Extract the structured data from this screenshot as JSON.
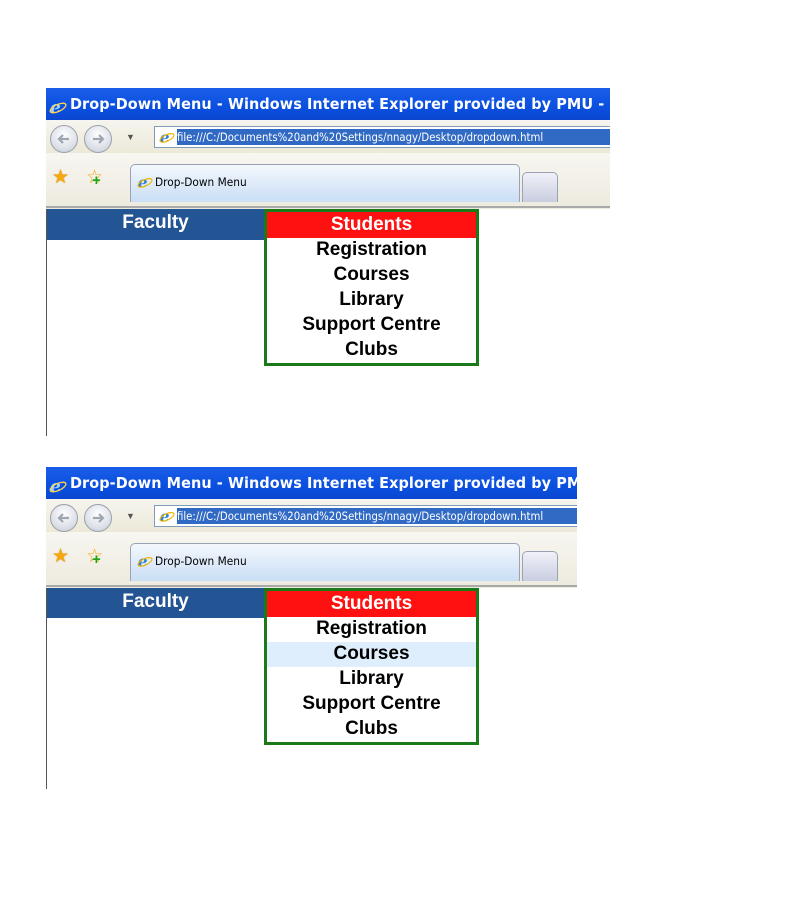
{
  "screenshots": [
    {
      "window_title": "Drop-Down Menu - Windows Internet Explorer provided by PMU - I",
      "address_url": "file:///C:/Documents%20and%20Settings/nnagy/Desktop/dropdown.html",
      "tab_label": "Drop-Down Menu",
      "nav": {
        "faculty": "Faculty",
        "students": "Students"
      },
      "menu_items": [
        "Registration",
        "Courses",
        "Library",
        "Support Centre",
        "Clubs"
      ],
      "hovered_item": null
    },
    {
      "window_title": "Drop-Down Menu - Windows Internet Explorer provided by PMU",
      "address_url": "file:///C:/Documents%20and%20Settings/nnagy/Desktop/dropdown.html",
      "tab_label": "Drop-Down Menu",
      "nav": {
        "faculty": "Faculty",
        "students": "Students"
      },
      "menu_items": [
        "Registration",
        "Courses",
        "Library",
        "Support Centre",
        "Clubs"
      ],
      "hovered_item": "Courses"
    }
  ],
  "icons": {
    "back": "back-arrow-icon",
    "forward": "forward-arrow-icon",
    "favorites": "favorites-star-icon",
    "add_favorites": "add-favorites-icon",
    "ie": "internet-explorer-icon"
  },
  "colors": {
    "titlebar": "#0b4fe0",
    "faculty_bg": "#235594",
    "students_bg": "#ff1111",
    "menu_border": "#1a7a1a",
    "hover_bg": "#dfeefc",
    "url_selection": "#316ac5"
  }
}
